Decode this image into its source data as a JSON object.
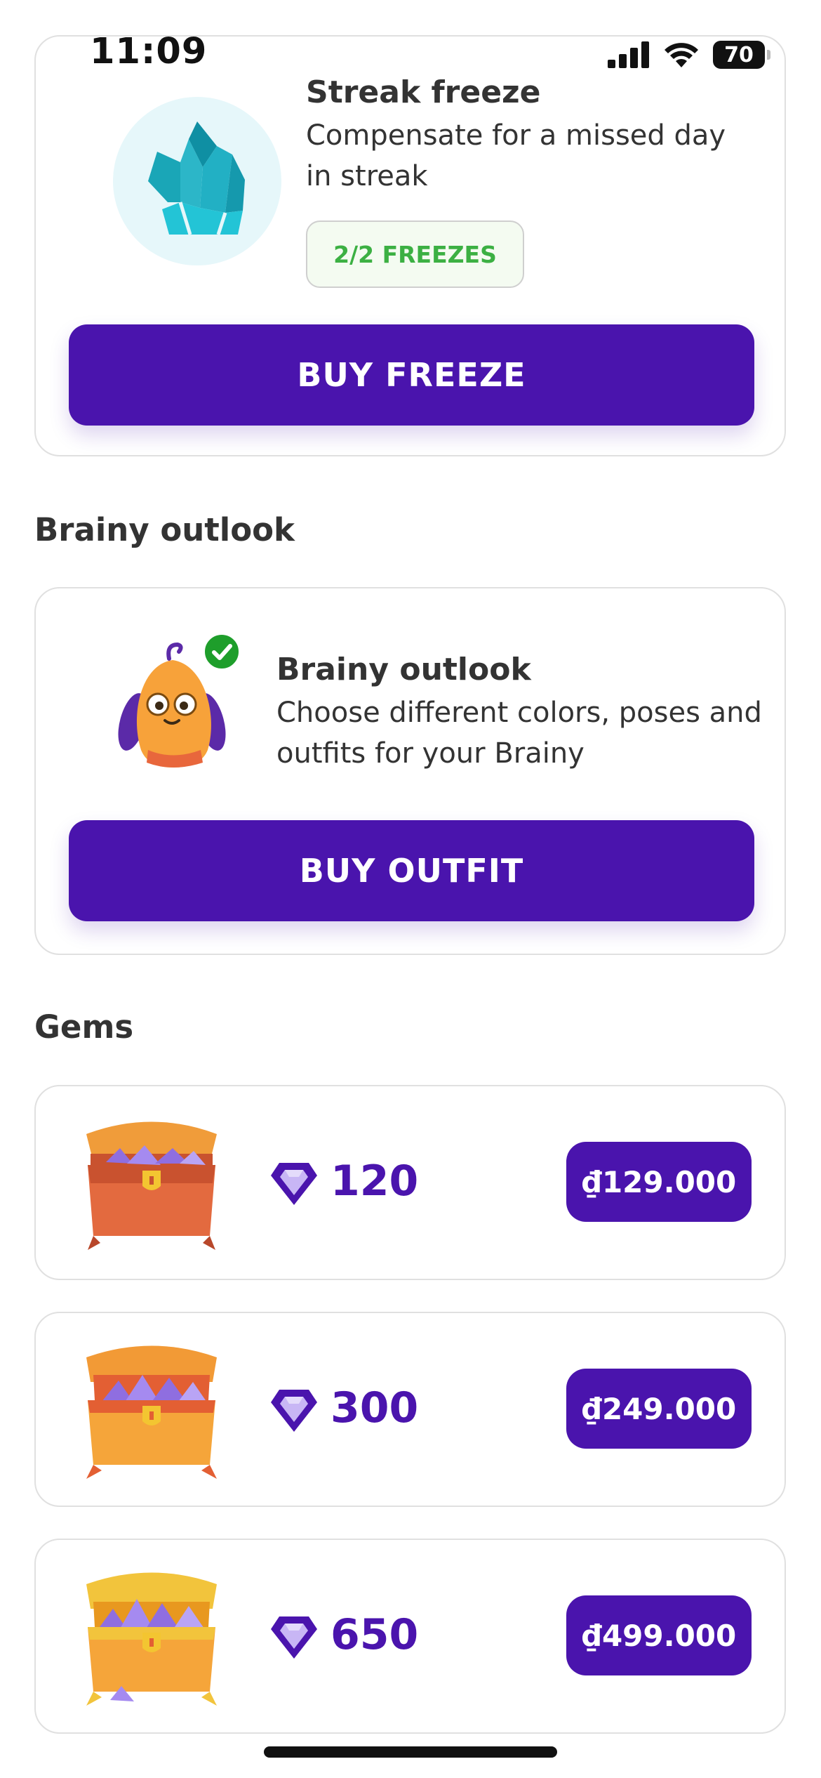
{
  "status_bar": {
    "time": "11:09",
    "battery": "70"
  },
  "streak_freeze": {
    "title": "Streak freeze",
    "description_line1": "Compensate for a missed day",
    "description_line2": "in streak",
    "badge": "2/2 FREEZES",
    "button": "BUY FREEZE",
    "icon": "ice-crystal-icon"
  },
  "outlook_section": {
    "heading": "Brainy outlook",
    "card_title": "Brainy outlook",
    "description_line1": "Choose different colors, poses and",
    "description_line2": "outfits for your Brainy",
    "button": "BUY OUTFIT",
    "icon": "brainy-mascot-icon",
    "check_icon": "checkmark-icon"
  },
  "gems_section": {
    "heading": "Gems",
    "packs": [
      {
        "amount": "120",
        "price": "₫129.000",
        "chest_icon": "treasure-chest-small-icon"
      },
      {
        "amount": "300",
        "price": "₫249.000",
        "chest_icon": "treasure-chest-medium-icon"
      },
      {
        "amount": "650",
        "price": "₫499.000",
        "chest_icon": "treasure-chest-large-icon"
      }
    ]
  },
  "colors": {
    "primary": "#4a14ad",
    "success": "#3cb043",
    "card_border": "#e0e0e0",
    "text": "#333333"
  }
}
